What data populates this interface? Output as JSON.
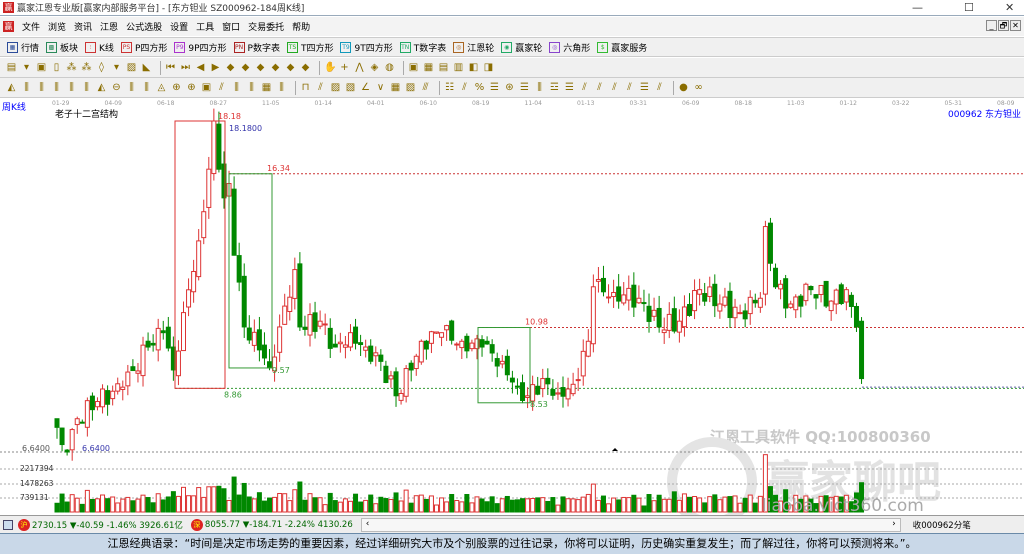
{
  "window": {
    "title": "赢家江恩专业版[赢家内部服务平台] - [东方钽业  SZ000962-184周K线]",
    "min": "—",
    "max": "☐",
    "close": "✕"
  },
  "menu": [
    "文件",
    "浏览",
    "资讯",
    "江恩",
    "公式选股",
    "设置",
    "工具",
    "窗口",
    "交易委托",
    "帮助"
  ],
  "mdi": [
    "_",
    "🗗",
    "✕"
  ],
  "toolbar": [
    {
      "icon": "▦",
      "label": "行情",
      "color": "#2b4c9a"
    },
    {
      "icon": "▩",
      "label": "板块",
      "color": "#2a8a5a"
    },
    {
      "icon": "⫶",
      "label": "K线",
      "color": "#c33"
    },
    {
      "icon": "PS",
      "label": "P四方形",
      "color": "#c33"
    },
    {
      "icon": "P9",
      "label": "9P四方形",
      "color": "#a3c"
    },
    {
      "icon": "PN",
      "label": "P数字表",
      "color": "#a22"
    },
    {
      "icon": "TS",
      "label": "T四方形",
      "color": "#2a2"
    },
    {
      "icon": "T9",
      "label": "9T四方形",
      "color": "#19b"
    },
    {
      "icon": "TN",
      "label": "T数字表",
      "color": "#2a6"
    },
    {
      "icon": "◎",
      "label": "江恩轮",
      "color": "#a62"
    },
    {
      "icon": "◉",
      "label": "赢家轮",
      "color": "#2a6"
    },
    {
      "icon": "◎",
      "label": "六角形",
      "color": "#84c"
    },
    {
      "icon": "$",
      "label": "赢家服务",
      "color": "#3b3"
    }
  ],
  "chart": {
    "period_label": "周K线",
    "name": "老子十二宫结构",
    "code": "000962",
    "stock": "东方钽业",
    "dates": [
      "01-29",
      "04-09",
      "06-18",
      "08-27",
      "11-05",
      "01-14",
      "04-01",
      "06-10",
      "08-19",
      "11-04",
      "01-13",
      "03-31",
      "06-09",
      "08-18",
      "11-03",
      "01-12",
      "03-22",
      "05-31",
      "08-09"
    ],
    "labels": {
      "high": "18.18",
      "high_exact": "18.1800",
      "l1634": "16.34",
      "l1098": "10.98",
      "l957": "9.57",
      "l886": "8.86",
      "l853": "8.53",
      "low_exact": "6.6400",
      "low_axis": "6.6400"
    },
    "volume_axis": [
      "2217394",
      "1478263",
      "739131"
    ],
    "watermark1": "江恩工具软件  QQ:100800360",
    "watermark2": "赢家聊吧",
    "watermark3": "liaoba.vict360.com"
  },
  "chart_data": {
    "type": "candlestick",
    "price_range": [
      6.64,
      18.18
    ],
    "close_keypoints": [
      [
        0,
        7.5
      ],
      [
        1,
        6.9
      ],
      [
        2,
        6.64
      ],
      [
        4,
        7.8
      ],
      [
        8,
        8.4
      ],
      [
        13,
        8.9
      ],
      [
        18,
        10.3
      ],
      [
        21,
        10.8
      ],
      [
        23,
        9.5
      ],
      [
        25,
        11.5
      ],
      [
        28,
        14
      ],
      [
        30,
        16.5
      ],
      [
        31,
        18.18
      ],
      [
        33,
        15.5
      ],
      [
        34,
        16
      ],
      [
        35,
        13.5
      ],
      [
        37,
        11
      ],
      [
        40,
        10.2
      ],
      [
        42,
        9.6
      ],
      [
        44,
        11
      ],
      [
        47,
        13
      ],
      [
        48,
        11
      ],
      [
        52,
        11.2
      ],
      [
        55,
        10.3
      ],
      [
        58,
        10.8
      ],
      [
        61,
        10.3
      ],
      [
        64,
        9.8
      ],
      [
        67,
        8.6
      ],
      [
        70,
        9.5
      ],
      [
        72,
        10.5
      ],
      [
        76,
        10.8
      ],
      [
        80,
        10.5
      ],
      [
        84,
        10.3
      ],
      [
        88,
        9.8
      ],
      [
        91,
        8.9
      ],
      [
        93,
        8.6
      ],
      [
        96,
        9.2
      ],
      [
        99,
        8.7
      ],
      [
        102,
        9
      ],
      [
        105,
        10.5
      ],
      [
        106,
        12.4
      ],
      [
        110,
        12.2
      ],
      [
        115,
        12
      ],
      [
        119,
        11
      ],
      [
        123,
        11.2
      ],
      [
        127,
        12.3
      ],
      [
        131,
        11.8
      ],
      [
        135,
        11.5
      ],
      [
        139,
        12
      ],
      [
        140,
        14.5
      ],
      [
        142,
        12.4
      ],
      [
        145,
        11.8
      ],
      [
        149,
        12.3
      ],
      [
        153,
        11.9
      ],
      [
        156,
        12.3
      ],
      [
        158,
        11
      ],
      [
        159,
        9.2
      ]
    ],
    "volume_max": 2956525
  },
  "status": {
    "sh_label": "沪",
    "sh": "2730.15 ▼-40.59 -1.46% 3926.61亿",
    "sz_label": "深",
    "sz": "8055.77 ▼-184.71 -2.24% 4130.26",
    "right": "收000962分笔"
  },
  "quote": "江恩经典语录：“时间是决定市场走势的重要因素，经过详细研究大市及个别股票的过往记录，你将可以证明，历史确实重复发生；而了解过往，你将可以预测将来。”。"
}
